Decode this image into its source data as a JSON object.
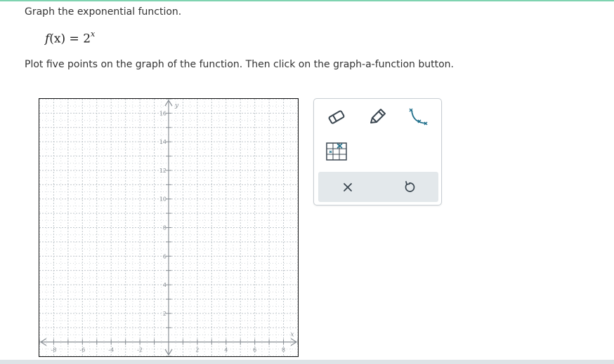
{
  "question": {
    "prompt": "Graph the exponential function.",
    "function_name": "f",
    "function_var": "(x)",
    "function_eq": " = 2",
    "function_exp": "x",
    "instruction": "Plot five points on the graph of the function. Then click on the graph-a-function button."
  },
  "graph": {
    "x_axis_label": "x",
    "y_axis_label": "y",
    "x_range": [
      -9,
      9
    ],
    "y_range": [
      -1,
      17
    ],
    "x_ticks": [
      -8,
      -6,
      -4,
      -2,
      2,
      4,
      6,
      8
    ],
    "y_ticks": [
      2,
      4,
      6,
      8,
      10,
      12,
      14,
      16
    ],
    "grid": true,
    "colors": {
      "grid": "#b9c0c6",
      "axis": "#8a9096",
      "label": "#8a9096"
    }
  },
  "tools": {
    "eraser": "eraser-icon",
    "pencil": "pencil-icon",
    "graph_function": "graph-a-function-icon",
    "table": "table-of-values-icon",
    "clear": "clear-icon",
    "undo": "undo-icon",
    "icon_color": "#3a4650",
    "accent_color": "#1f6f8b"
  }
}
